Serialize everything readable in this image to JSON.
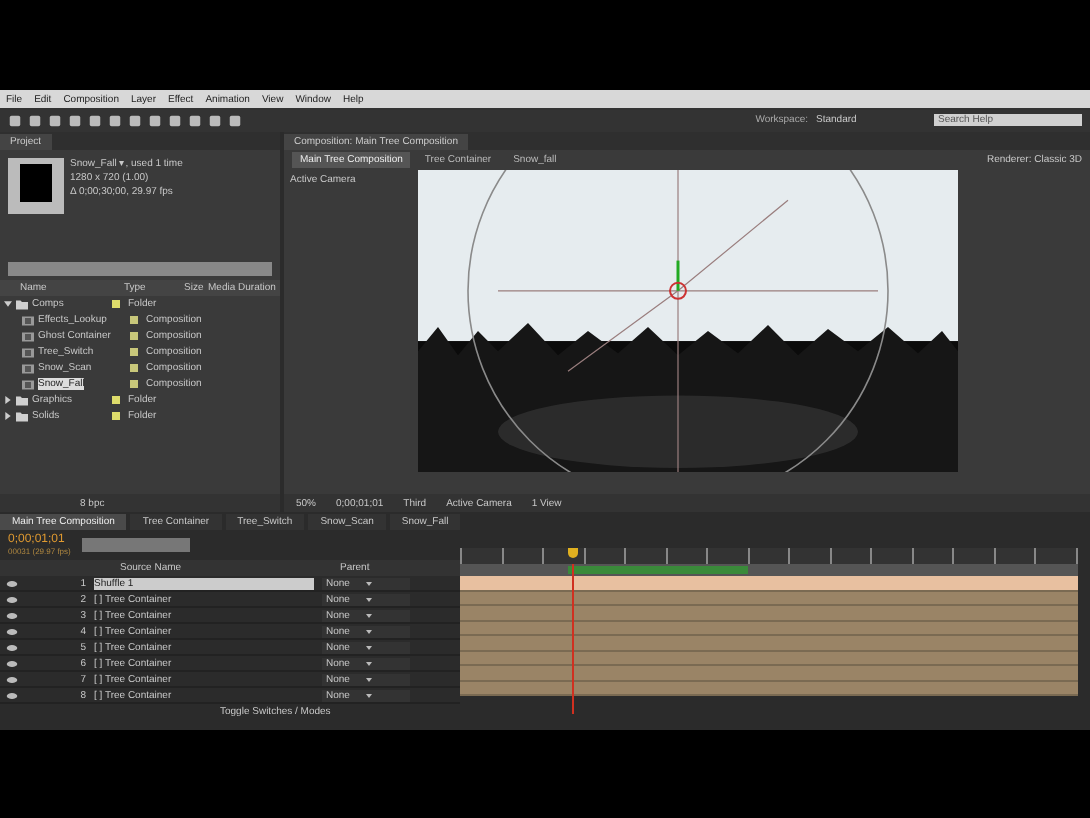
{
  "menu": [
    "File",
    "Edit",
    "Composition",
    "Layer",
    "Effect",
    "Animation",
    "View",
    "Window",
    "Help"
  ],
  "toolbar": {
    "workspace_label": "Workspace:",
    "workspace": "Standard",
    "search_placeholder": "Search Help"
  },
  "project": {
    "tab": "Project",
    "info": [
      "Snow_Fall ▾, used 1 time",
      "1280 x 720 (1.00)",
      "Δ 0;00;30;00, 29.97 fps"
    ],
    "columns": [
      "Name",
      "Type",
      "Size",
      "Media Duration"
    ],
    "items": [
      {
        "name": "Comps",
        "type": "Folder",
        "kind": "folder",
        "expanded": true,
        "selected": false,
        "children": [
          {
            "name": "Effects_Lookup",
            "type": "Composition",
            "kind": "comp",
            "selected": false
          },
          {
            "name": "Ghost Container",
            "type": "Composition",
            "kind": "comp",
            "selected": false
          },
          {
            "name": "Tree_Switch",
            "type": "Composition",
            "kind": "comp",
            "selected": false
          },
          {
            "name": "Snow_Scan",
            "type": "Composition",
            "kind": "comp",
            "selected": false
          },
          {
            "name": "Snow_Fall",
            "type": "Composition",
            "kind": "comp",
            "selected": true
          }
        ]
      },
      {
        "name": "Graphics",
        "type": "Folder",
        "kind": "folder",
        "expanded": false,
        "selected": false
      },
      {
        "name": "Solids",
        "type": "Folder",
        "kind": "folder",
        "expanded": false,
        "selected": false
      }
    ],
    "footer": "8 bpc"
  },
  "viewer": {
    "tab": "Composition: Main Tree Composition",
    "breadcrumbs": [
      {
        "label": "Main Tree Composition",
        "selected": true
      },
      {
        "label": "Tree Container",
        "selected": false
      },
      {
        "label": "Snow_fall",
        "selected": false
      }
    ],
    "renderer": "Renderer: Classic 3D",
    "camera": "Active Camera",
    "controls": [
      "50%",
      "0;00;01;01",
      "Third",
      "Active Camera",
      "1 View"
    ]
  },
  "timeline": {
    "tabs": [
      {
        "label": "Main Tree Composition",
        "selected": true
      },
      {
        "label": "Tree Container",
        "selected": false
      },
      {
        "label": "Tree_Switch",
        "selected": false
      },
      {
        "label": "Snow_Scan",
        "selected": false
      },
      {
        "label": "Snow_Fall",
        "selected": false
      }
    ],
    "timecode": "0;00;01;01",
    "fps": "00031 (29.97 fps)",
    "columns": [
      "Source Name",
      "Parent"
    ],
    "layers": [
      {
        "num": "1",
        "name": "Shuffle 1",
        "parent": "None",
        "selected": true
      },
      {
        "num": "2",
        "name": "[ ] Tree Container",
        "parent": "None",
        "selected": false
      },
      {
        "num": "3",
        "name": "[ ] Tree Container",
        "parent": "None",
        "selected": false
      },
      {
        "num": "4",
        "name": "[ ] Tree Container",
        "parent": "None",
        "selected": false
      },
      {
        "num": "5",
        "name": "[ ] Tree Container",
        "parent": "None",
        "selected": false
      },
      {
        "num": "6",
        "name": "[ ] Tree Container",
        "parent": "None",
        "selected": false
      },
      {
        "num": "7",
        "name": "[ ] Tree Container",
        "parent": "None",
        "selected": false
      },
      {
        "num": "8",
        "name": "[ ] Tree Container",
        "parent": "None",
        "selected": false
      }
    ],
    "footer": "Toggle Switches / Modes"
  }
}
